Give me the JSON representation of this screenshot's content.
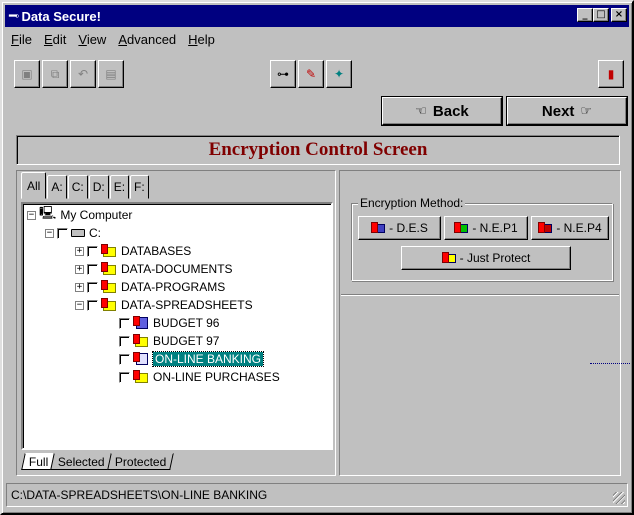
{
  "window": {
    "title": "Data Secure!",
    "minimize": "_",
    "maximize": "□",
    "close": "×"
  },
  "menu": [
    "File",
    "Edit",
    "View",
    "Advanced",
    "Help"
  ],
  "nav": {
    "back_label": "Back",
    "next_label": "Next"
  },
  "screen_title": "Encryption Control Screen",
  "drive_tabs": [
    "All",
    "A:",
    "C:",
    "D:",
    "E:",
    "F:"
  ],
  "tree": {
    "root": "My Computer",
    "drive": "C:",
    "folders": [
      "DATABASES",
      "DATA-DOCUMENTS",
      "DATA-PROGRAMS",
      "DATA-SPREADSHEETS"
    ],
    "files": [
      "BUDGET 96",
      "BUDGET 97",
      "ON-LINE BANKING",
      "ON-LINE PURCHASES"
    ],
    "selected": "ON-LINE BANKING"
  },
  "bottom_tabs": [
    "Full",
    "Selected",
    "Protected"
  ],
  "encryption": {
    "group_label": "Encryption Method:",
    "des_label": "- D.E.S",
    "nep1_label": "- N.E.P1",
    "nep4_label": "- N.E.P4",
    "just_protect_label": "- Just Protect"
  },
  "status": {
    "path": "C:\\DATA-SPREADSHEETS\\ON-LINE BANKING"
  },
  "colors": {
    "title_bar": "#000080",
    "heading": "#800000",
    "selection": "#008080",
    "face": "#c0c0c0"
  }
}
